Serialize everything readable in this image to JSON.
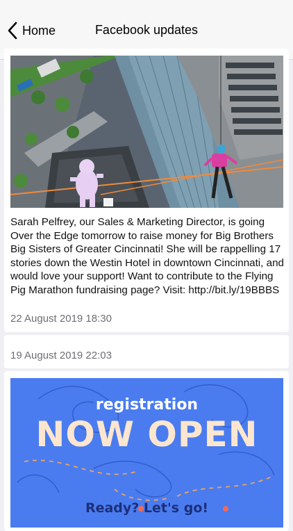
{
  "nav": {
    "back_label": "Home",
    "title": "Facebook updates"
  },
  "posts": [
    {
      "text": "Sarah Pelfrey, our Sales & Marketing Director, is going Over the Edge tomorrow to raise money for Big Brothers Big Sisters of Greater Cincinnati! She will be rappelling 17 stories down the Westin Hotel in downtown Cincinnati, and would love your support! Want to contribute to the Flying Pig Marathon fundraising page? Visit: http://bit.ly/19BBBS",
      "timestamp": "22 August 2019 18:30"
    },
    {
      "timestamp": "19 August 2019 22:03"
    },
    {
      "image": {
        "heading": "registration",
        "headline": "NOW OPEN",
        "tagline": "Ready? Let's go!"
      }
    }
  ],
  "colors": {
    "background": "#efeff4",
    "promo_blue": "#4a7cf0",
    "promo_headline": "#fde6cf",
    "promo_tagline": "#1c2f7a"
  }
}
